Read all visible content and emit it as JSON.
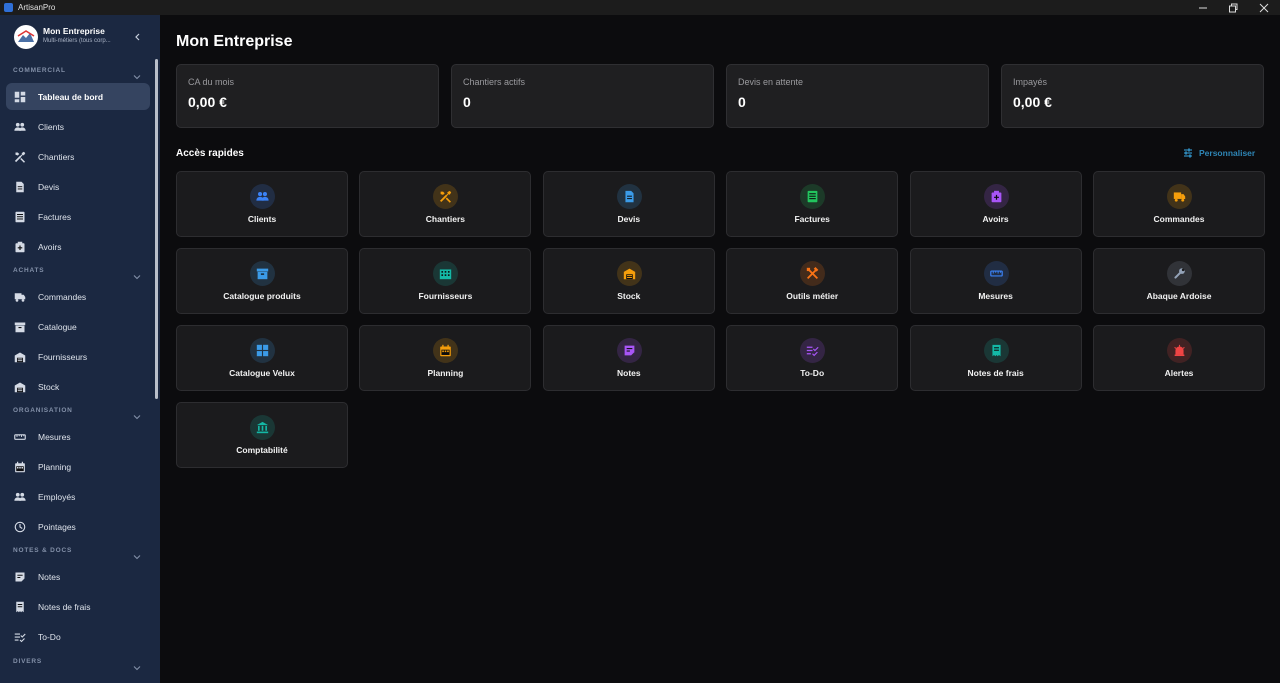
{
  "window": {
    "title": "ArtisanPro"
  },
  "sidebar": {
    "company_name": "Mon Entreprise",
    "company_sub": "Multi-métiers (tous corp...",
    "sections": [
      {
        "label": "COMMERCIAL",
        "items": [
          {
            "label": "Tableau de bord",
            "icon": "dashboard-icon",
            "active": true
          },
          {
            "label": "Clients",
            "icon": "people-icon"
          },
          {
            "label": "Chantiers",
            "icon": "tools-icon"
          },
          {
            "label": "Devis",
            "icon": "document-icon"
          },
          {
            "label": "Factures",
            "icon": "invoice-icon"
          },
          {
            "label": "Avoirs",
            "icon": "credit-note-icon"
          }
        ]
      },
      {
        "label": "ACHATS",
        "items": [
          {
            "label": "Commandes",
            "icon": "truck-icon"
          },
          {
            "label": "Catalogue",
            "icon": "archive-icon"
          },
          {
            "label": "Fournisseurs",
            "icon": "warehouse-icon"
          },
          {
            "label": "Stock",
            "icon": "warehouse-icon"
          }
        ]
      },
      {
        "label": "ORGANISATION",
        "items": [
          {
            "label": "Mesures",
            "icon": "ruler-icon"
          },
          {
            "label": "Planning",
            "icon": "calendar-icon"
          },
          {
            "label": "Employés",
            "icon": "people-icon"
          },
          {
            "label": "Pointages",
            "icon": "clock-icon"
          }
        ]
      },
      {
        "label": "NOTES & DOCS",
        "items": [
          {
            "label": "Notes",
            "icon": "note-icon"
          },
          {
            "label": "Notes de frais",
            "icon": "receipt-icon"
          },
          {
            "label": "To-Do",
            "icon": "checklist-icon"
          }
        ]
      },
      {
        "label": "DIVERS",
        "items": []
      }
    ]
  },
  "main": {
    "title": "Mon Entreprise",
    "kpis": [
      {
        "label": "CA du mois",
        "value": "0,00 €"
      },
      {
        "label": "Chantiers actifs",
        "value": "0"
      },
      {
        "label": "Devis en attente",
        "value": "0"
      },
      {
        "label": "Impayés",
        "value": "0,00 €"
      }
    ],
    "quick_access_title": "Accès rapides",
    "customize_label": "Personnaliser",
    "tiles": [
      {
        "label": "Clients",
        "icon": "people-icon",
        "color": "#3b82f6"
      },
      {
        "label": "Chantiers",
        "icon": "tools-icon",
        "color": "#f59e0b"
      },
      {
        "label": "Devis",
        "icon": "document-icon",
        "color": "#3b9be8"
      },
      {
        "label": "Factures",
        "icon": "invoice-icon",
        "color": "#22c55e"
      },
      {
        "label": "Avoirs",
        "icon": "credit-note-icon",
        "color": "#a855f7"
      },
      {
        "label": "Commandes",
        "icon": "truck-icon",
        "color": "#f59e0b"
      },
      {
        "label": "Catalogue produits",
        "icon": "archive-icon",
        "color": "#3b9be8"
      },
      {
        "label": "Fournisseurs",
        "icon": "building-icon",
        "color": "#14b8a6"
      },
      {
        "label": "Stock",
        "icon": "warehouse-icon",
        "color": "#f59e0b"
      },
      {
        "label": "Outils métier",
        "icon": "crossed-tools-icon",
        "color": "#f97316"
      },
      {
        "label": "Mesures",
        "icon": "ruler-icon",
        "color": "#3b82f6"
      },
      {
        "label": "Abaque Ardoise",
        "icon": "wrench-icon",
        "color": "#94a3b8"
      },
      {
        "label": "Catalogue Velux",
        "icon": "window-icon",
        "color": "#3b9be8"
      },
      {
        "label": "Planning",
        "icon": "calendar-icon",
        "color": "#f59e0b"
      },
      {
        "label": "Notes",
        "icon": "note-icon",
        "color": "#a855f7"
      },
      {
        "label": "To-Do",
        "icon": "checklist-icon",
        "color": "#a855f7"
      },
      {
        "label": "Notes de frais",
        "icon": "receipt-icon",
        "color": "#14b8a6"
      },
      {
        "label": "Alertes",
        "icon": "alarm-icon",
        "color": "#ef4444"
      },
      {
        "label": "Comptabilité",
        "icon": "bank-icon",
        "color": "#14b8a6"
      }
    ]
  }
}
